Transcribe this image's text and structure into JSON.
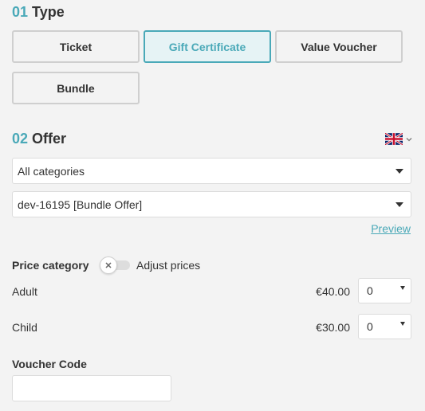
{
  "type_section": {
    "number": "01",
    "title": "Type",
    "options": [
      {
        "label": "Ticket",
        "selected": false
      },
      {
        "label": "Gift Certificate",
        "selected": true
      },
      {
        "label": "Value Voucher",
        "selected": false
      },
      {
        "label": "Bundle",
        "selected": false
      }
    ]
  },
  "offer_section": {
    "number": "02",
    "title": "Offer",
    "language_icon": "uk-flag-icon",
    "category_select": {
      "value": "All categories"
    },
    "offer_select": {
      "value": "dev-16195 [Bundle Offer]"
    },
    "preview_link": "Preview"
  },
  "pricing": {
    "heading": "Price category",
    "toggle_label": "Adjust prices",
    "toggle_on": false,
    "rows": [
      {
        "name": "Adult",
        "price": "€40.00",
        "quantity": "0"
      },
      {
        "name": "Child",
        "price": "€30.00",
        "quantity": "0"
      }
    ]
  },
  "voucher": {
    "label": "Voucher Code",
    "value": ""
  },
  "colors": {
    "accent": "#4aa9b8",
    "background": "#f3f3f3"
  }
}
